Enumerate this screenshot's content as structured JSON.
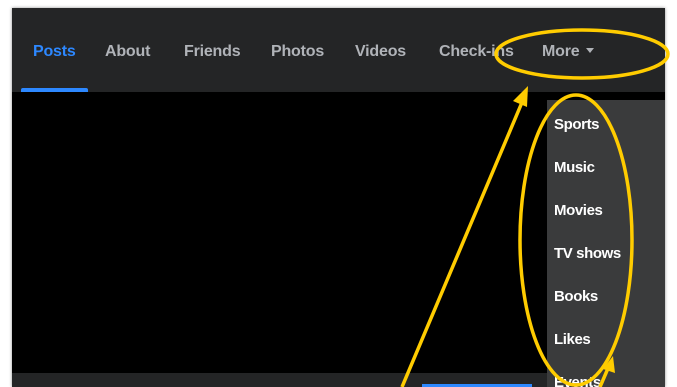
{
  "tabs": [
    {
      "label": "Posts",
      "active": true
    },
    {
      "label": "About"
    },
    {
      "label": "Friends"
    },
    {
      "label": "Photos"
    },
    {
      "label": "Videos"
    },
    {
      "label": "Check-ins"
    },
    {
      "label": "More"
    }
  ],
  "more_menu": {
    "items": [
      {
        "label": "Sports"
      },
      {
        "label": "Music"
      },
      {
        "label": "Movies"
      },
      {
        "label": "TV shows"
      },
      {
        "label": "Books"
      },
      {
        "label": "Likes"
      },
      {
        "label": "Events"
      }
    ]
  },
  "colors": {
    "accent": "#2d88ff",
    "tabbar_bg": "#242526",
    "menu_bg": "#3a3b3c",
    "tab_text": "#b0b3b8",
    "annotation": "#ffcc00"
  },
  "icons": {
    "more_caret": "caret-down-icon"
  }
}
